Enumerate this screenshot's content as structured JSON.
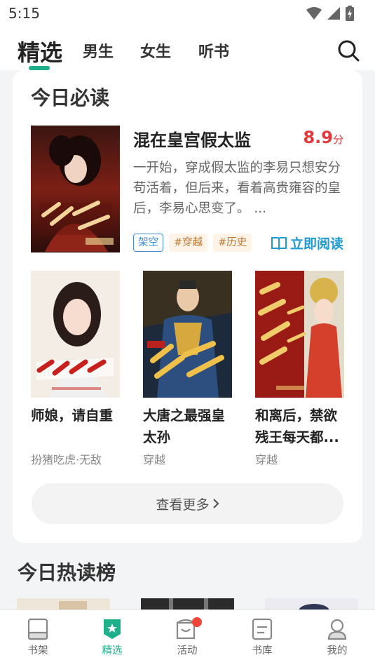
{
  "status_bar": {
    "time": "5:15"
  },
  "tabs": [
    {
      "label": "精选"
    },
    {
      "label": "男生"
    },
    {
      "label": "女生"
    },
    {
      "label": "听书"
    }
  ],
  "today": {
    "title": "今日必读",
    "featured": {
      "title": "混在皇宫假太监",
      "score": "8.9",
      "score_unit": "分",
      "description": "一开始，穿成假太监的李易只想安分苟活着，但后来，看着高贵雍容的皇后，李易心思变了。 ...",
      "tags": [
        "架空",
        "#穿越",
        "#历史"
      ],
      "read_label": "立即阅读"
    },
    "books": [
      {
        "title": "师娘，请自重",
        "meta": "扮猪吃虎·无敌"
      },
      {
        "title": "大唐之最强皇太孙",
        "meta": "穿越"
      },
      {
        "title": "和离后，禁欲残王每天都...",
        "meta": "穿越"
      }
    ],
    "more_label": "查看更多"
  },
  "hot": {
    "title": "今日热读榜"
  },
  "bottom_nav": [
    {
      "label": "书架"
    },
    {
      "label": "精选"
    },
    {
      "label": "活动"
    },
    {
      "label": "书库"
    },
    {
      "label": "我的"
    }
  ],
  "colors": {
    "accent": "#1eb08a",
    "score": "#e2393c",
    "link": "#1e9ad3",
    "badge": "#f0453a"
  },
  "icons": [
    "wifi-icon",
    "signal-icon",
    "battery-icon",
    "search-icon",
    "read-book-icon",
    "chevron-right-icon",
    "bookshelf-icon",
    "featured-icon",
    "activity-icon",
    "library-icon",
    "profile-icon"
  ]
}
